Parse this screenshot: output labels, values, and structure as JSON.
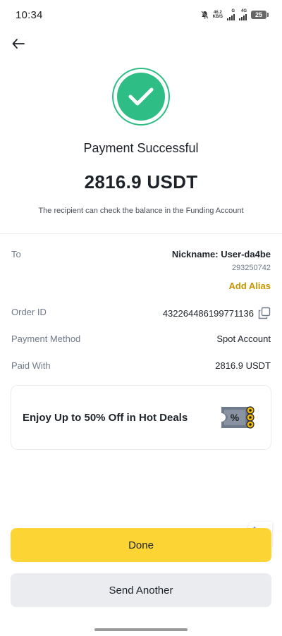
{
  "status_bar": {
    "time": "10:34",
    "speed_top": "46.2",
    "speed_bottom": "KB/S",
    "network_a": "G",
    "network_b": "4G",
    "battery": "25"
  },
  "header": {
    "back_icon": "arrow-left-icon"
  },
  "result": {
    "icon": "check-circle-icon",
    "icon_color": "#2ebd85",
    "title": "Payment Successful",
    "amount": "2816.9 USDT",
    "subtitle": "The recipient can check the balance in the Funding Account"
  },
  "details": {
    "to_label": "To",
    "nickname": "Nickname: User-da4be",
    "account_id": "293250742",
    "add_alias": "Add Alias",
    "order_label": "Order ID",
    "order_id": "432264486199771136",
    "method_label": "Payment Method",
    "method_value": "Spot Account",
    "paid_label": "Paid With",
    "paid_value": "2816.9 USDT"
  },
  "promo": {
    "text": "Enjoy Up to 50% Off in Hot Deals",
    "icon": "coupon-icon"
  },
  "actions": {
    "done_label": "Done",
    "send_another_label": "Send Another"
  },
  "colors": {
    "primary_yellow": "#fcd535",
    "alias_gold": "#c99400",
    "secondary_gray": "#eaecef"
  }
}
